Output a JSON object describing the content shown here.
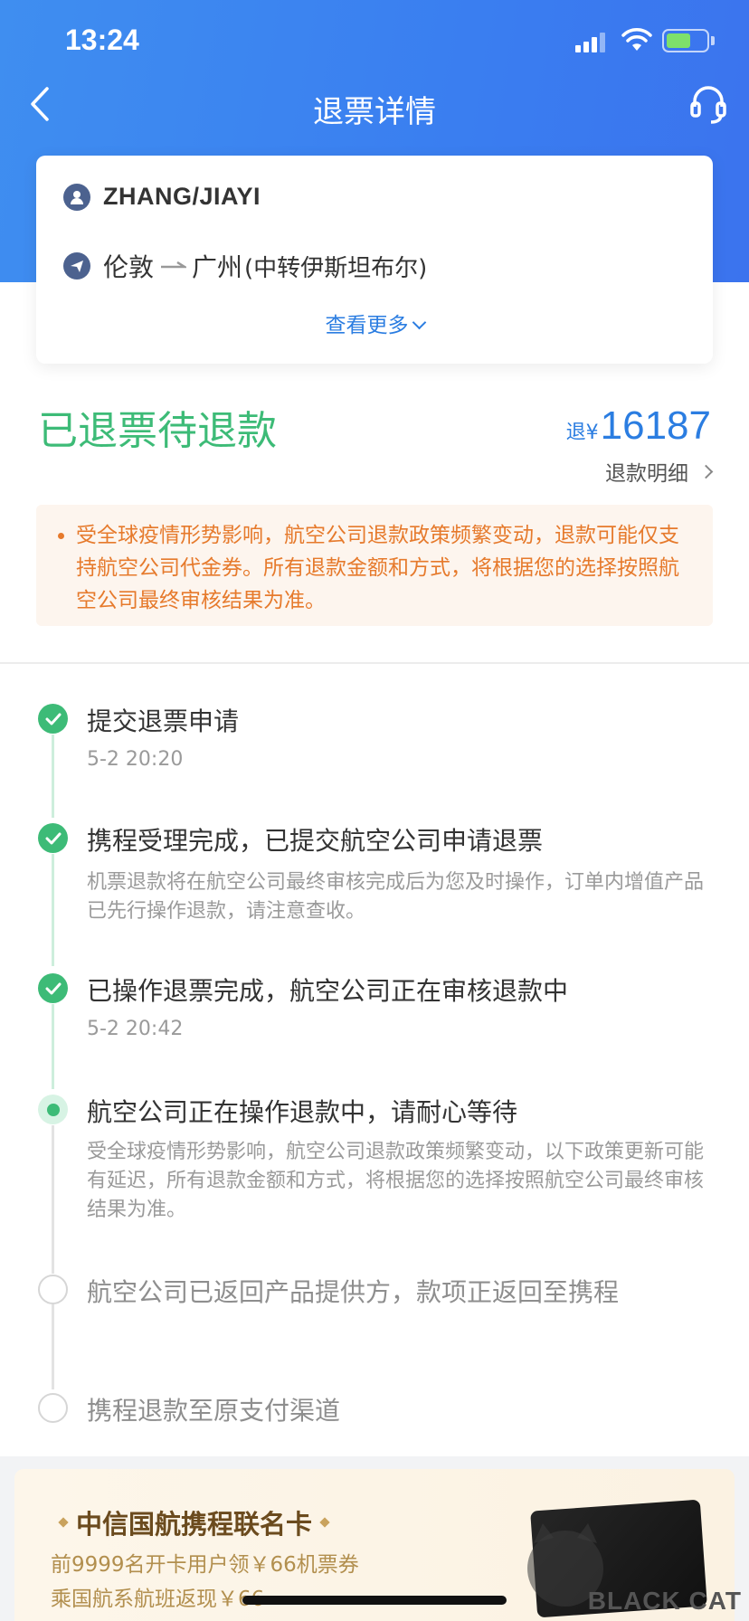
{
  "status_bar": {
    "time": "13:24"
  },
  "nav": {
    "title": "退票详情"
  },
  "passenger_card": {
    "name": "ZHANG/JIAYI",
    "from_city": "伦敦",
    "to_city": "广州",
    "via": "(中转伊斯坦布尔)",
    "see_more": "查看更多"
  },
  "refund": {
    "status": "已退票待退款",
    "amount_prefix": "退",
    "currency": "¥",
    "amount": "16187",
    "detail_link": "退款明细"
  },
  "notice": "受全球疫情形势影响，航空公司退款政策频繁变动，退款可能仅支持航空公司代金券。所有退款金额和方式，将根据您的选择按照航空公司最终审核结果为准。",
  "timeline": [
    {
      "title": "提交退票申请",
      "sub": "5-2 20:20",
      "state": "done"
    },
    {
      "title": "携程受理完成，已提交航空公司申请退票",
      "sub": "机票退款将在航空公司最终审核完成后为您及时操作，订单内增值产品已先行操作退款，请注意查收。",
      "state": "done"
    },
    {
      "title": "已操作退票完成，航空公司正在审核退款中",
      "sub": "5-2 20:42",
      "state": "done"
    },
    {
      "title": "航空公司正在操作退款中，请耐心等待",
      "sub": "受全球疫情形势影响，航空公司退款政策频繁变动，以下政策更新可能有延迟，所有退款金额和方式，将根据您的选择按照航空公司最终审核结果为准。",
      "state": "current"
    },
    {
      "title": "航空公司已返回产品提供方，款项正返回至携程",
      "sub": "",
      "state": "todo"
    },
    {
      "title": "携程退款至原支付渠道",
      "sub": "",
      "state": "todo"
    }
  ],
  "promo": {
    "title": "中信国航携程联名卡",
    "line1": "前9999名开卡用户领￥66机票券",
    "line2": "乘国航系航班返现￥66"
  },
  "watermark": {
    "text": "BLACK CAT"
  },
  "colors": {
    "header_blue": "#3a7ef0",
    "success_green": "#3dbb77",
    "link_blue": "#2b7de1",
    "warning_orange": "#e67a2c"
  },
  "icons": [
    "back-arrow-icon",
    "customer-service-headset-icon",
    "user-icon",
    "plane-icon",
    "chevron-down-icon",
    "chevron-right-icon",
    "check-icon"
  ]
}
